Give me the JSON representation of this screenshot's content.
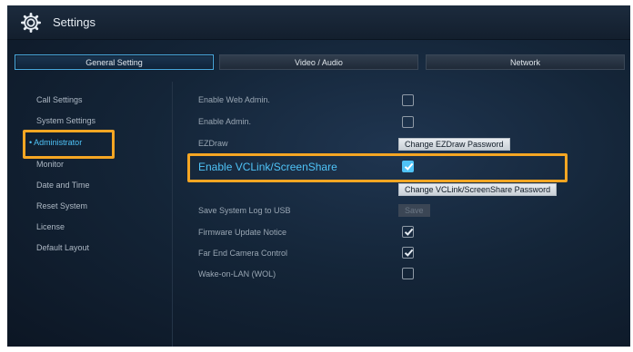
{
  "header": {
    "title": "Settings"
  },
  "tabs": [
    {
      "label": "General Setting",
      "active": true
    },
    {
      "label": "Video / Audio",
      "active": false
    },
    {
      "label": "Network",
      "active": false
    }
  ],
  "sidebar": {
    "items": [
      {
        "label": "Call Settings"
      },
      {
        "label": "System Settings"
      },
      {
        "label": "Administrator",
        "active": true,
        "prefix": "•"
      },
      {
        "label": "Monitor"
      },
      {
        "label": "Date and Time"
      },
      {
        "label": "Reset System"
      },
      {
        "label": "License"
      },
      {
        "label": "Default Layout"
      }
    ]
  },
  "settings": {
    "enable_web_admin": {
      "label": "Enable Web Admin.",
      "checked": false
    },
    "enable_admin": {
      "label": "Enable Admin.",
      "checked": false
    },
    "ezdraw": {
      "label": "EZDraw",
      "button": "Change EZDraw Password"
    },
    "enable_vclink": {
      "label": "Enable VCLink/ScreenShare",
      "checked": true,
      "button": "Change VCLink/ScreenShare Password"
    },
    "save_log": {
      "label": "Save System Log to USB",
      "button": "Save"
    },
    "firmware_notice": {
      "label": "Firmware Update Notice",
      "checked": true
    },
    "far_end_camera": {
      "label": "Far End Camera Control",
      "checked": true
    },
    "wake_on_lan": {
      "label": "Wake-on-LAN (WOL)",
      "checked": false
    }
  },
  "colors": {
    "accent": "#4fc3f7",
    "highlight": "#f5a623",
    "background": "#142538"
  },
  "icons": {
    "header": "gear-icon",
    "checkbox_checked": "checkmark-icon"
  }
}
